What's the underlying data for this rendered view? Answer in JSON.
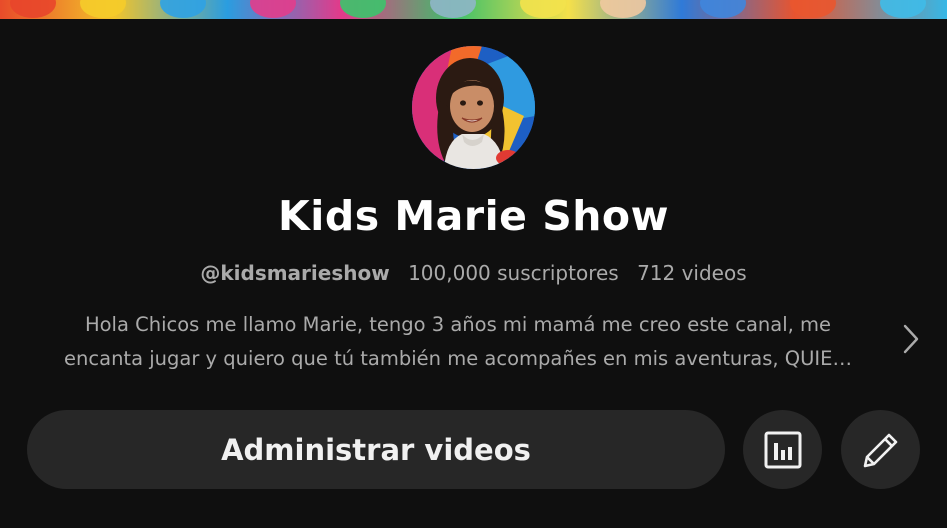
{
  "channel": {
    "name": "Kids Marie Show",
    "handle": "@kidsmarieshow",
    "subscribers": "100,000 suscriptores",
    "videos": "712 videos",
    "description_line1": "Hola Chicos me llamo  Marie, tengo 3 años mi mamá me creo este canal, me",
    "description_line2": "encanta jugar y quiero que tú también me acompañes en mis aventuras, QUIE…"
  },
  "actions": {
    "manage_videos_label": "Administrar videos"
  },
  "icons": {
    "avatar": "channel-avatar",
    "chevron": "chevron-right-icon",
    "stats": "analytics-icon",
    "edit": "pencil-icon"
  },
  "colors": {
    "background": "#0f0f0f",
    "button": "#272727",
    "text_primary": "#f1f1f1",
    "text_secondary": "#aaaaaa"
  }
}
